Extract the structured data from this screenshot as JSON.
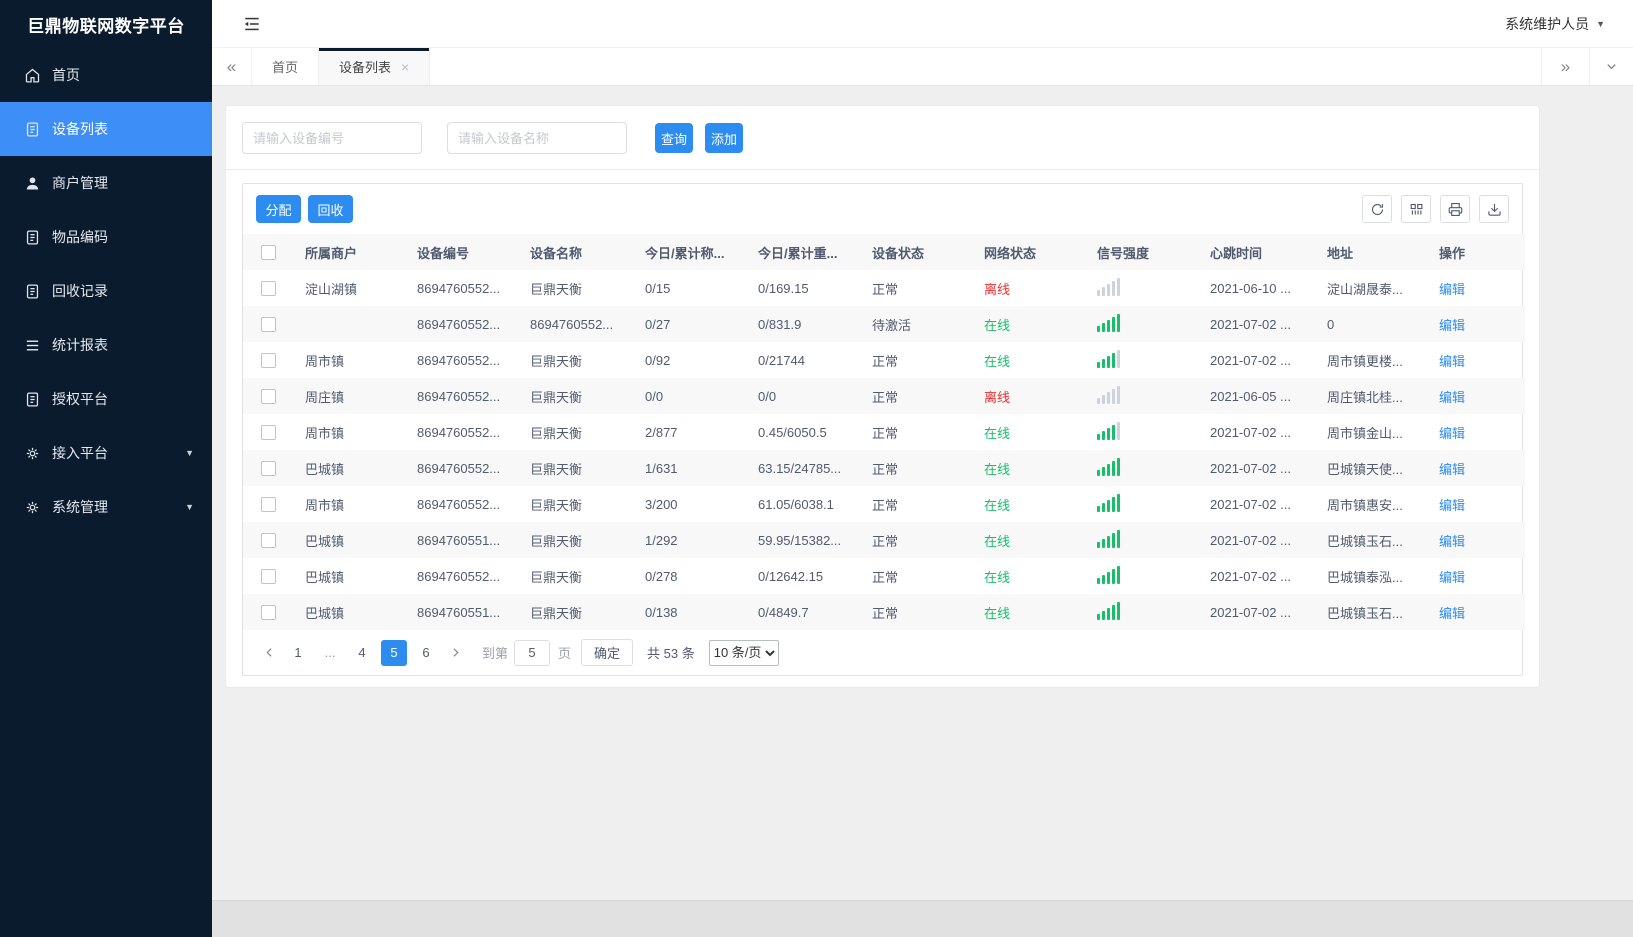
{
  "colors": {
    "primary": "#2d8cf0",
    "sidebar_active": "#3e8ef7",
    "online": "#19be6b",
    "offline": "#ed2f2f"
  },
  "brand": {
    "title": "巨鼎物联网数字平台"
  },
  "sidebar": {
    "items": [
      {
        "label": "首页",
        "icon": "home",
        "active": false,
        "arrow": false
      },
      {
        "label": "设备列表",
        "icon": "doc",
        "active": true,
        "arrow": false
      },
      {
        "label": "商户管理",
        "icon": "user",
        "active": false,
        "arrow": false
      },
      {
        "label": "物品编码",
        "icon": "doc",
        "active": false,
        "arrow": false
      },
      {
        "label": "回收记录",
        "icon": "doc",
        "active": false,
        "arrow": false
      },
      {
        "label": "统计报表",
        "icon": "list",
        "active": false,
        "arrow": false
      },
      {
        "label": "授权平台",
        "icon": "doc",
        "active": false,
        "arrow": false
      },
      {
        "label": "接入平台",
        "icon": "gear",
        "active": false,
        "arrow": true
      },
      {
        "label": "系统管理",
        "icon": "gear",
        "active": false,
        "arrow": true
      }
    ]
  },
  "header": {
    "user_name": "系统维护人员"
  },
  "tabs": {
    "home": "首页",
    "active": "设备列表"
  },
  "search": {
    "device_no_placeholder": "请输入设备编号",
    "device_name_placeholder": "请输入设备名称",
    "query": "查询",
    "add": "添加"
  },
  "toolbar": {
    "assign": "分配",
    "recycle": "回收"
  },
  "table": {
    "columns": [
      "所属商户",
      "设备编号",
      "设备名称",
      "今日/累计称...",
      "今日/累计重...",
      "设备状态",
      "网络状态",
      "信号强度",
      "心跳时间",
      "地址",
      "操作"
    ],
    "edit_label": "编辑",
    "rows": [
      {
        "merchant": "淀山湖镇",
        "device_no": "8694760552...",
        "device_name": "巨鼎天衡",
        "today_count": "0/15",
        "today_weight": "0/169.15",
        "status": "正常",
        "network": "离线",
        "online": false,
        "signal": 0,
        "heartbeat": "2021-06-10 ...",
        "address": "淀山湖晟泰..."
      },
      {
        "merchant": "",
        "device_no": "8694760552...",
        "device_name": "8694760552...",
        "today_count": "0/27",
        "today_weight": "0/831.9",
        "status": "待激活",
        "network": "在线",
        "online": true,
        "signal": 5,
        "heartbeat": "2021-07-02 ...",
        "address": "0"
      },
      {
        "merchant": "周市镇",
        "device_no": "8694760552...",
        "device_name": "巨鼎天衡",
        "today_count": "0/92",
        "today_weight": "0/21744",
        "status": "正常",
        "network": "在线",
        "online": true,
        "signal": 4,
        "heartbeat": "2021-07-02 ...",
        "address": "周市镇更楼..."
      },
      {
        "merchant": "周庄镇",
        "device_no": "8694760552...",
        "device_name": "巨鼎天衡",
        "today_count": "0/0",
        "today_weight": "0/0",
        "status": "正常",
        "network": "离线",
        "online": false,
        "signal": 0,
        "heartbeat": "2021-06-05 ...",
        "address": "周庄镇北桂..."
      },
      {
        "merchant": "周市镇",
        "device_no": "8694760552...",
        "device_name": "巨鼎天衡",
        "today_count": "2/877",
        "today_weight": "0.45/6050.5",
        "status": "正常",
        "network": "在线",
        "online": true,
        "signal": 4,
        "heartbeat": "2021-07-02 ...",
        "address": "周市镇金山..."
      },
      {
        "merchant": "巴城镇",
        "device_no": "8694760552...",
        "device_name": "巨鼎天衡",
        "today_count": "1/631",
        "today_weight": "63.15/24785...",
        "status": "正常",
        "network": "在线",
        "online": true,
        "signal": 5,
        "heartbeat": "2021-07-02 ...",
        "address": "巴城镇天使..."
      },
      {
        "merchant": "周市镇",
        "device_no": "8694760552...",
        "device_name": "巨鼎天衡",
        "today_count": "3/200",
        "today_weight": "61.05/6038.1",
        "status": "正常",
        "network": "在线",
        "online": true,
        "signal": 5,
        "heartbeat": "2021-07-02 ...",
        "address": "周市镇惠安..."
      },
      {
        "merchant": "巴城镇",
        "device_no": "8694760551...",
        "device_name": "巨鼎天衡",
        "today_count": "1/292",
        "today_weight": "59.95/15382...",
        "status": "正常",
        "network": "在线",
        "online": true,
        "signal": 5,
        "heartbeat": "2021-07-02 ...",
        "address": "巴城镇玉石..."
      },
      {
        "merchant": "巴城镇",
        "device_no": "8694760552...",
        "device_name": "巨鼎天衡",
        "today_count": "0/278",
        "today_weight": "0/12642.15",
        "status": "正常",
        "network": "在线",
        "online": true,
        "signal": 5,
        "heartbeat": "2021-07-02 ...",
        "address": "巴城镇泰泓..."
      },
      {
        "merchant": "巴城镇",
        "device_no": "8694760551...",
        "device_name": "巨鼎天衡",
        "today_count": "0/138",
        "today_weight": "0/4849.7",
        "status": "正常",
        "network": "在线",
        "online": true,
        "signal": 5,
        "heartbeat": "2021-07-02 ...",
        "address": "巴城镇玉石..."
      }
    ]
  },
  "pagination": {
    "pages": [
      "1",
      "...",
      "4",
      "5",
      "6"
    ],
    "current": "5",
    "goto_label": "到第",
    "goto_value": "5",
    "page_label": "页",
    "confirm": "确定",
    "total": "共 53 条",
    "page_size": "10 条/页"
  }
}
